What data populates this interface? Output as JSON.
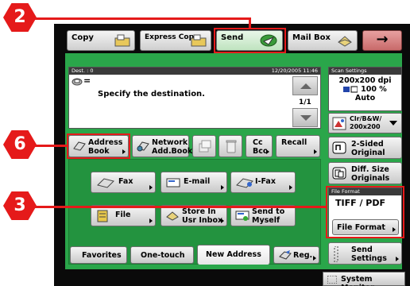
{
  "tabs": {
    "copy": "Copy",
    "express_copy": "Express Copy",
    "send": "Send",
    "mail_box": "Mail Box",
    "next_arrow": "→"
  },
  "destination": {
    "header_left": "Dest. :   0",
    "header_right": "12/20/2005 11:46",
    "message": "Specify the destination.",
    "prefix": "=",
    "page_indicator": "1/1"
  },
  "scan_settings": {
    "header": "Scan Settings",
    "resolution": "200x200 dpi",
    "zoom": "100 %",
    "mode": "Auto",
    "color_select_line1": "Clr/B&W/",
    "color_select_line2": "200x200"
  },
  "row1": {
    "address_book_1": "Address",
    "address_book_2": "Book",
    "network_1": "Network",
    "network_2": "Add.Book",
    "cc_1": "Cc",
    "cc_2": "Bcc",
    "recall": "Recall"
  },
  "side_buttons": {
    "two_sided_1": "2-Sided",
    "two_sided_2": "Original",
    "diff_size_1": "Diff. Size",
    "diff_size_2": "Originals"
  },
  "file_format": {
    "header": "File Format",
    "value": "TIFF / PDF",
    "button": "File Format"
  },
  "send_settings_1": "Send",
  "send_settings_2": "Settings",
  "dest_types": {
    "fax": "Fax",
    "email": "E-mail",
    "ifax": "I-Fax",
    "file": "File",
    "store_1": "Store In",
    "store_2": "Usr Inbox",
    "send_myself_1": "Send to",
    "send_myself_2": "Myself"
  },
  "bottom_tabs": {
    "favorites": "Favorites",
    "one_touch": "One-touch",
    "new_address": "New Address",
    "reg": "Reg."
  },
  "system_monitor": "System Monitor",
  "callouts": {
    "two": "2",
    "six": "6",
    "three": "3"
  },
  "colors": {
    "panel_green": "#2aa64a",
    "highlight_red": "#e51a1a"
  }
}
